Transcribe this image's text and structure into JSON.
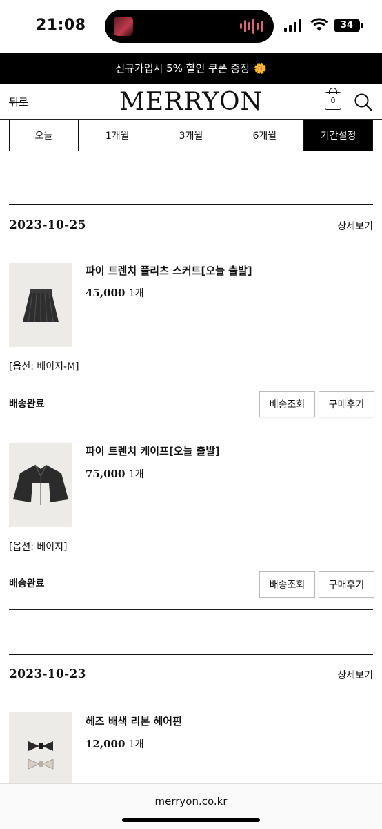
{
  "status_bar": {
    "time": "21:08",
    "battery": "34"
  },
  "promo": {
    "text": "신규가입시 5% 할인 쿠폰 증정",
    "emoji": "🌼"
  },
  "header": {
    "back_label": "뒤로",
    "logo": "MERRYON",
    "cart_count": "0"
  },
  "period_tabs": [
    {
      "label": "오늘",
      "active": false
    },
    {
      "label": "1개월",
      "active": false
    },
    {
      "label": "3개월",
      "active": false
    },
    {
      "label": "6개월",
      "active": false
    },
    {
      "label": "기간설정",
      "active": true
    }
  ],
  "orders": [
    {
      "date": "2023-10-25",
      "detail_label": "상세보기",
      "items": [
        {
          "name": "파이 트렌치 플리츠 스커트[오늘 출발]",
          "price": "45,000",
          "qty": "1개",
          "option": "[옵션: 베이지-M]",
          "status": "배송완료",
          "track_label": "배송조회",
          "review_label": "구매후기",
          "thumb_icon": "skirt-image"
        },
        {
          "name": "파이 트렌치 케이프[오늘 출발]",
          "price": "75,000",
          "qty": "1개",
          "option": "[옵션: 베이지]",
          "status": "배송완료",
          "track_label": "배송조회",
          "review_label": "구매후기",
          "thumb_icon": "cape-image"
        }
      ]
    },
    {
      "date": "2023-10-23",
      "detail_label": "상세보기",
      "items": [
        {
          "name": "헤즈 배색 리본 헤어핀",
          "price": "12,000",
          "qty": "1개",
          "thumb_icon": "ribbon-hairpin-image"
        }
      ]
    }
  ],
  "footer": {
    "url": "merryon.co.kr"
  }
}
